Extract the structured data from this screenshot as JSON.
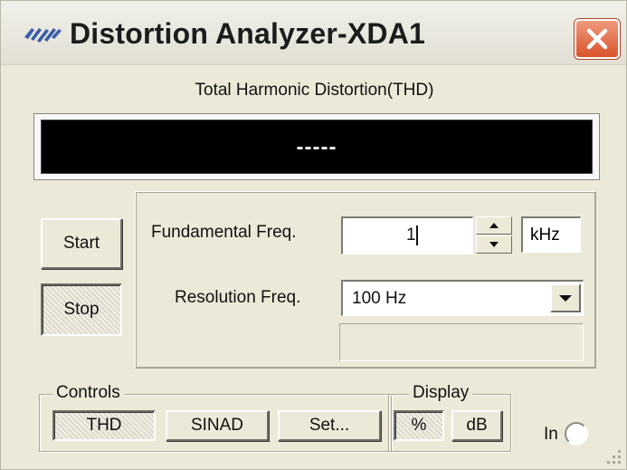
{
  "window": {
    "title": "Distortion Analyzer-XDA1",
    "title_icon": "instrument-logo-icon",
    "close_icon": "close-icon"
  },
  "measurement": {
    "caption": "Total Harmonic Distortion(THD)",
    "display_value": "-----"
  },
  "run_buttons": {
    "start_label": "Start",
    "stop_label": "Stop",
    "active": "stop"
  },
  "parameters": {
    "fundamental_label": "Fundamental Freq.",
    "fundamental_value": "1",
    "fundamental_unit": "kHz",
    "resolution_label": "Resolution Freq.",
    "resolution_value": "100 Hz"
  },
  "controls_group": {
    "legend": "Controls",
    "thd_label": "THD",
    "sinad_label": "SINAD",
    "set_label": "Set...",
    "active": "thd"
  },
  "display_group": {
    "legend": "Display",
    "percent_label": "%",
    "db_label": "dB",
    "active": "percent"
  },
  "input_indicator": {
    "label": "In"
  },
  "colors": {
    "window_bg": "#ece9d8",
    "display_bg": "#000000",
    "display_text": "#f0f0f0",
    "close_button": "#d8532c"
  }
}
